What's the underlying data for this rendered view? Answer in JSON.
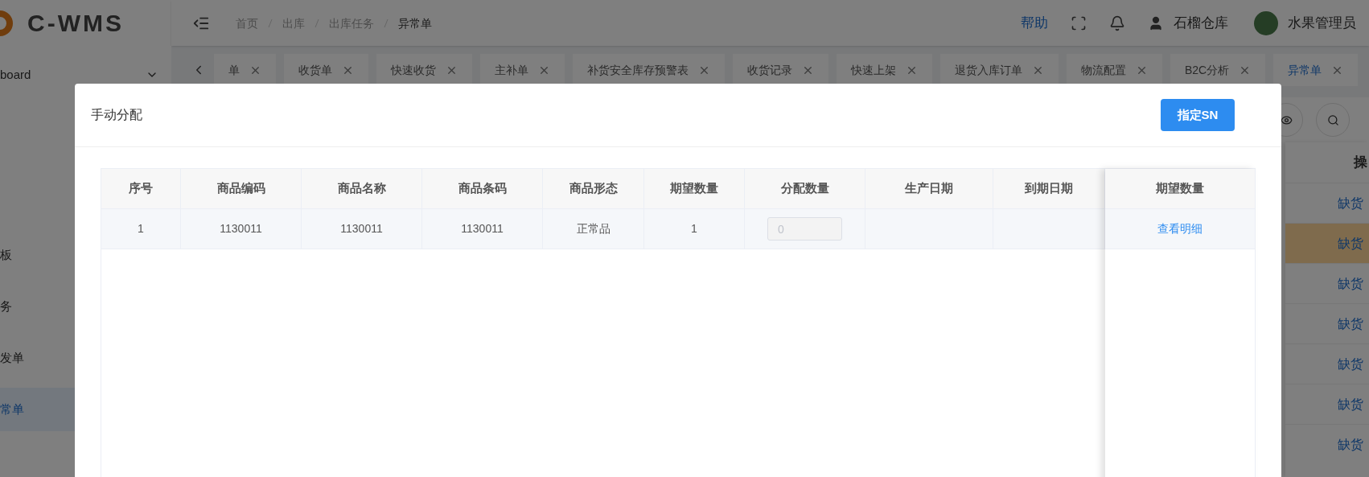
{
  "header": {
    "logo": "C-WMS",
    "breadcrumb": [
      "首页",
      "出库",
      "出库任务",
      "异常单"
    ],
    "help": "帮助",
    "warehouse": "石榴仓库",
    "user": "水果管理员"
  },
  "sidebar": {
    "items": [
      {
        "label": "board",
        "kind": "group",
        "selected": false
      },
      {
        "label": "板",
        "kind": "item",
        "selected": false
      },
      {
        "label": "务",
        "kind": "item",
        "selected": false
      },
      {
        "label": "发单",
        "kind": "item",
        "selected": false
      },
      {
        "label": "常单",
        "kind": "item",
        "selected": true
      }
    ]
  },
  "tabs": [
    {
      "label": "单",
      "selected": false
    },
    {
      "label": "收货单",
      "selected": false
    },
    {
      "label": "快速收货",
      "selected": false
    },
    {
      "label": "主补单",
      "selected": false
    },
    {
      "label": "补货安全库存预警表",
      "selected": false
    },
    {
      "label": "收货记录",
      "selected": false
    },
    {
      "label": "快速上架",
      "selected": false
    },
    {
      "label": "退货入库订单",
      "selected": false
    },
    {
      "label": "物流配置",
      "selected": false
    },
    {
      "label": "B2C分析",
      "selected": false
    },
    {
      "label": "异常单",
      "selected": true
    }
  ],
  "background_table": {
    "column": "操",
    "rows": [
      {
        "action": "缺货",
        "selected": false
      },
      {
        "action": "缺货",
        "selected": true
      },
      {
        "action": "缺货",
        "selected": false
      },
      {
        "action": "缺货",
        "selected": false
      },
      {
        "action": "缺货",
        "selected": false
      },
      {
        "action": "缺货",
        "selected": false
      },
      {
        "action": "缺货",
        "selected": false
      }
    ]
  },
  "dialog": {
    "title": "手动分配",
    "button": "指定SN",
    "table": {
      "columns": [
        "序号",
        "商品编码",
        "商品名称",
        "商品条码",
        "商品形态",
        "期望数量",
        "分配数量",
        "生产日期",
        "到期日期"
      ],
      "fixed_column": "期望数量",
      "rows": [
        {
          "cells": [
            "1",
            "1130011",
            "1130011",
            "1130011",
            "正常品",
            "1"
          ],
          "allocation": {
            "placeholder": "0",
            "disabled": true
          },
          "action": "查看明细"
        }
      ]
    }
  }
}
